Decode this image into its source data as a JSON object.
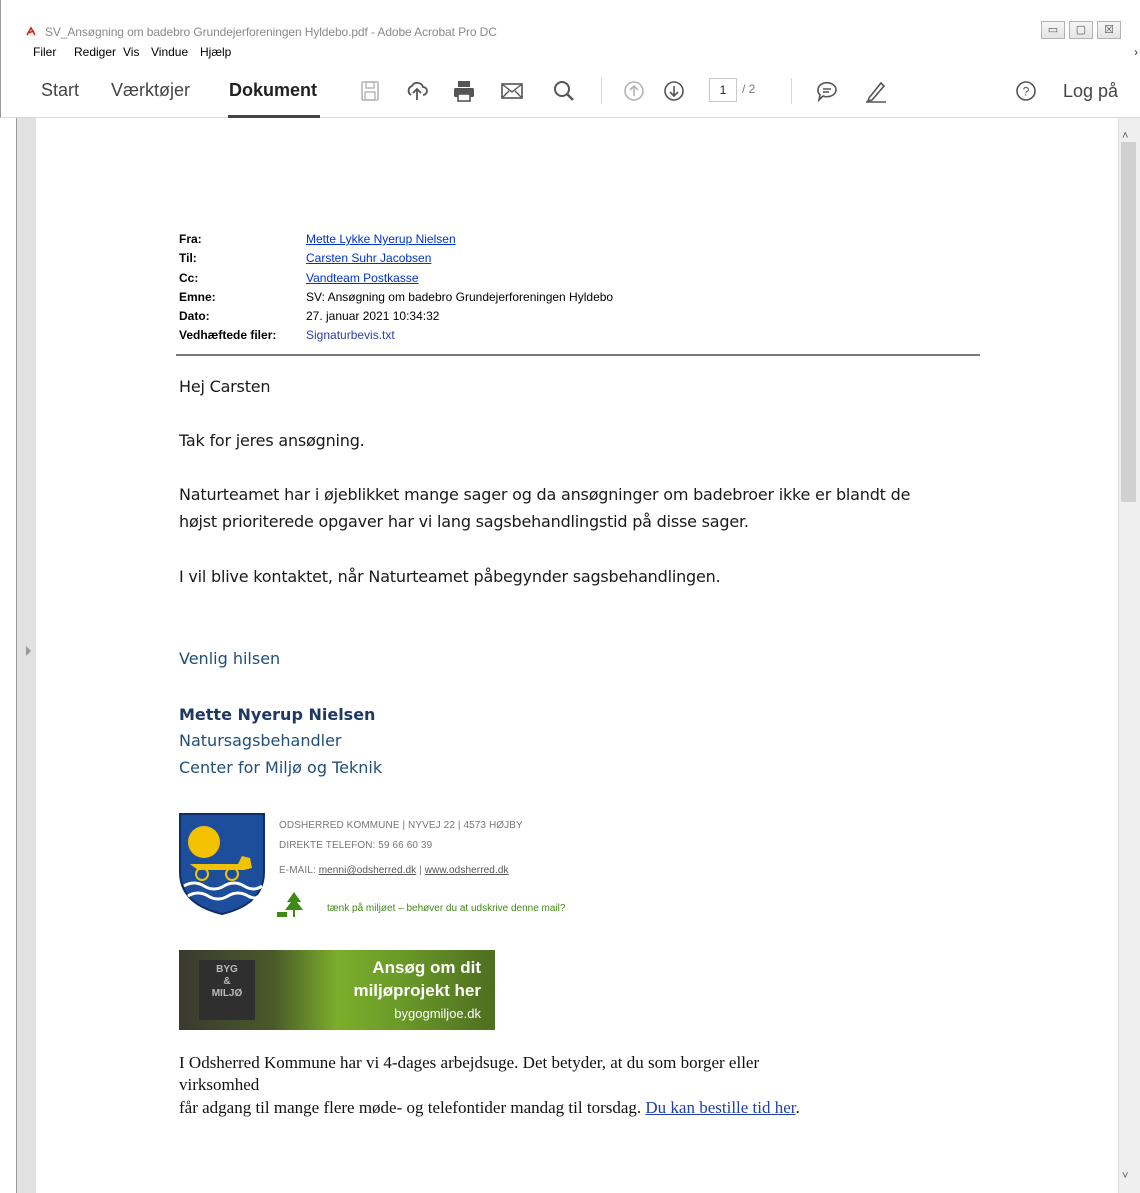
{
  "window": {
    "title": "SV_Ansøgning om badebro Grundejerforeningen Hyldebo.pdf - Adobe Acrobat Pro DC",
    "minimize": "▭",
    "maximize": "▢",
    "close": "☒"
  },
  "menu": {
    "items": [
      "Filer",
      "Rediger",
      "Vis",
      "Vindue",
      "Hjælp"
    ],
    "overflow": "›"
  },
  "toolbar": {
    "tabs": [
      "Start",
      "Værktøjer",
      "Dokument"
    ],
    "active_tab": "Dokument",
    "page_current": "1",
    "page_total": "/ 2",
    "sign_in": "Log på"
  },
  "email": {
    "header": {
      "from_label": "Fra:",
      "from_value": "Mette Lykke Nyerup Nielsen",
      "to_label": "Til:",
      "to_value": "Carsten Suhr Jacobsen",
      "cc_label": "Cc:",
      "cc_value": "Vandteam Postkasse",
      "subject_label": "Emne:",
      "subject_value": "SV: Ansøgning om badebro Grundejerforeningen Hyldebo",
      "date_label": "Dato:",
      "date_value": "27. januar 2021 10:34:32",
      "attachments_label": "Vedhæftede filer:",
      "attachments_value": "Signaturbevis.txt"
    },
    "body": {
      "greeting": "Hej Carsten",
      "line1": "Tak for jeres ansøgning.",
      "line2a": "Naturteamet har i øjeblikket mange sager og da ansøgninger om badebroer ikke er blandt de",
      "line2b": "højst prioriterede opgaver har vi lang sagsbehandlingstid på disse sager.",
      "line3": "I vil blive kontaktet, når Naturteamet påbegynder sagsbehandlingen."
    },
    "signature": {
      "closing": "Venlig hilsen",
      "name": "Mette Nyerup Nielsen",
      "title": "Natursagsbehandler",
      "department": "Center for Miljø og Teknik",
      "address": "ODSHERRED KOMMUNE  |  NYVEJ 22  |  4573 HØJBY",
      "phone": "DIREKTE TELEFON: 59 66 60 39",
      "email_prefix": "E-MAIL: ",
      "email": "menni@odsherred.dk",
      "email_sep": "  |  ",
      "website": "www.odsherred.dk",
      "green_note": "tænk på miljøet – behøver du at udskrive denne mail?"
    },
    "banner": {
      "badge_line1": "BYG",
      "badge_line2": "&",
      "badge_line3": "MILJØ",
      "headline1": "Ansøg om dit",
      "headline2": "miljøprojekt her",
      "url": "bygogmiljoe.dk"
    },
    "footer": {
      "line1": "I Odsherred Kommune har vi 4-dages arbejdsuge. Det betyder, at du som borger eller",
      "line2": "virksomhed",
      "line3": "får adgang til mange flere møde- og telefontider mandag til torsdag. ",
      "link": "Du kan bestille tid her",
      "period": "."
    }
  },
  "colors": {
    "link": "#0033cc",
    "signature_blue": "#1f4e79",
    "green_note": "#3f8a14"
  }
}
